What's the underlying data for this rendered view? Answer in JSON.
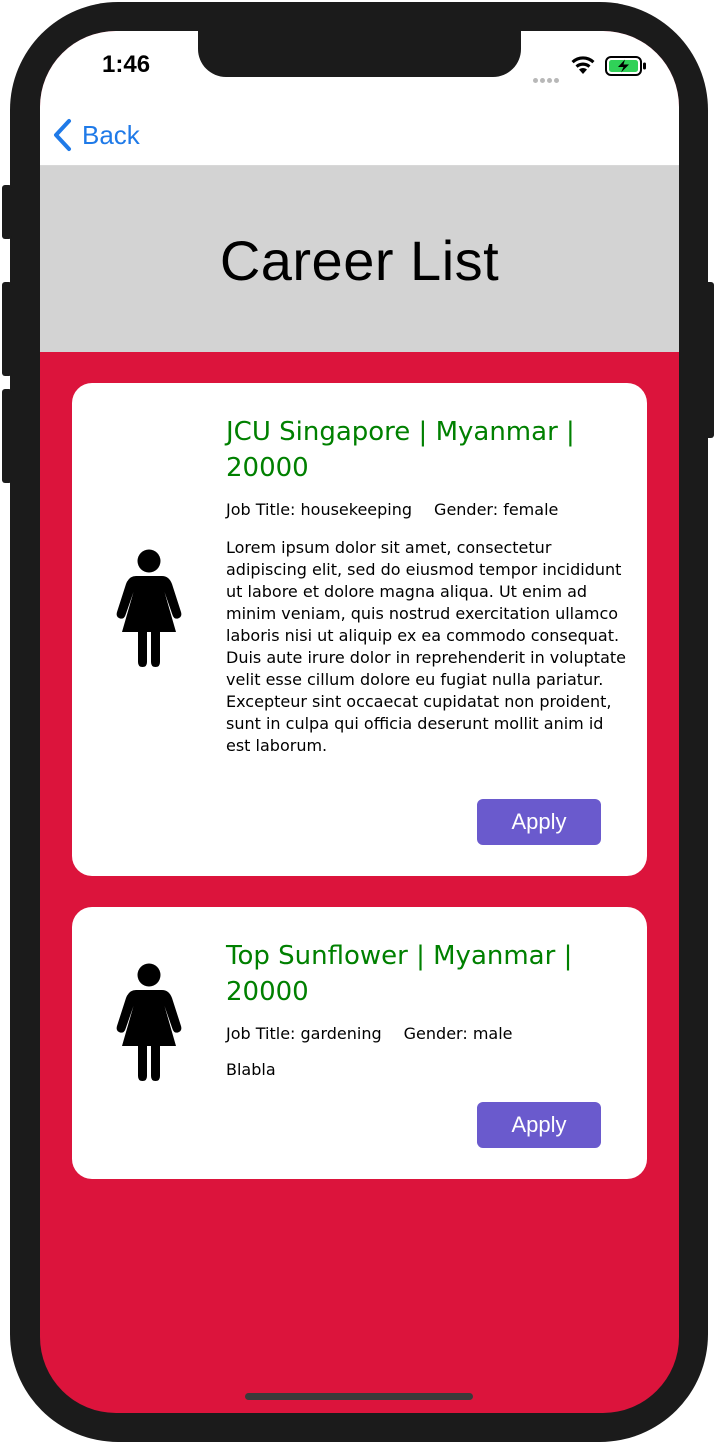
{
  "status_bar": {
    "time": "1:46",
    "signal_icon": "cellular-dots-icon",
    "wifi_icon": "wifi-icon",
    "battery_icon": "battery-charging-icon",
    "battery_color": "#30d158"
  },
  "nav": {
    "back_icon": "chevron-left-icon",
    "back_label": "Back",
    "accent_color": "#1f7ae8"
  },
  "header": {
    "title": "Career List",
    "background": "#d3d3d3"
  },
  "colors": {
    "page_background": "#dc143c",
    "card_background": "#ffffff",
    "title_color": "#008000",
    "button_color": "#6a5acd"
  },
  "careers": [
    {
      "icon": "female-person-icon",
      "title": "JCU Singapore | Myanmar | 20000",
      "job_title": "Job Title: housekeeping",
      "gender": "Gender: female",
      "description": "Lorem ipsum dolor sit amet, consectetur adipiscing elit, sed do eiusmod tempor incididunt ut labore et dolore magna aliqua. Ut enim ad minim veniam, quis nostrud exercitation ullamco laboris nisi ut aliquip ex ea commodo consequat. Duis aute irure dolor in reprehenderit in voluptate velit esse cillum dolore eu fugiat nulla pariatur. Excepteur sint occaecat cupidatat non proident, sunt in culpa qui officia deserunt mollit anim id est laborum.",
      "apply_label": "Apply"
    },
    {
      "icon": "female-person-icon",
      "title": "Top Sunflower | Myanmar | 20000",
      "job_title": "Job Title: gardening",
      "gender": "Gender: male",
      "description": "Blabla",
      "apply_label": "Apply"
    }
  ]
}
